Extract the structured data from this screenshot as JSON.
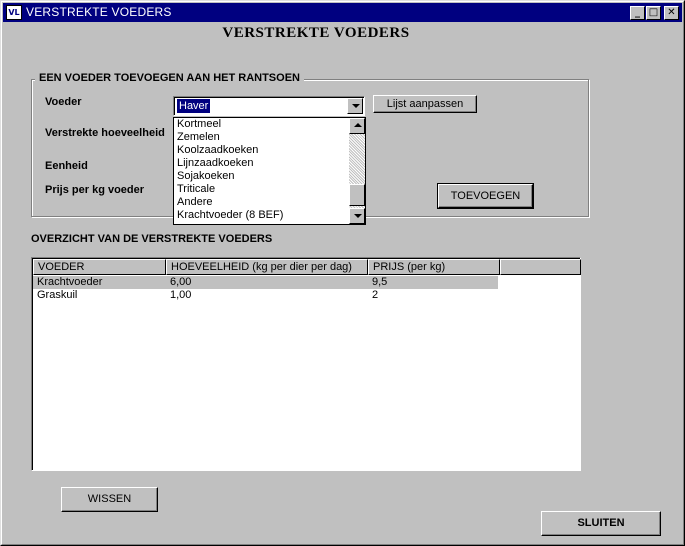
{
  "window": {
    "title": "VERSTREKTE VOEDERS",
    "icon_text": "VL",
    "min_glyph": "_",
    "max_glyph": "□",
    "close_glyph": "✕"
  },
  "page_title": "VERSTREKTE VOEDERS",
  "add_group": {
    "legend": "EEN VOEDER TOEVOEGEN AAN HET RANTSOEN",
    "labels": {
      "voeder": "Voeder",
      "hoeveelheid": "Verstrekte hoeveelheid",
      "eenheid": "Eenheid",
      "prijs": "Prijs per kg voeder"
    },
    "voeder_combo": {
      "selected": "Haver",
      "options": [
        "Kortmeel",
        "Zemelen",
        "Koolzaadkoeken",
        "Lijnzaadkoeken",
        "Sojakoeken",
        "Triticale",
        "Andere",
        "Krachtvoeder (8 BEF)"
      ]
    },
    "lijst_button": "Lijst aanpassen",
    "toevoegen_button": "TOEVOEGEN"
  },
  "overview": {
    "title": "OVERZICHT VAN DE VERSTREKTE VOEDERS",
    "columns": [
      "VOEDER",
      "HOEVEELHEID (kg per dier per dag)",
      "PRIJS (per kg)",
      ""
    ],
    "rows": [
      {
        "voeder": "Krachtvoeder",
        "hoeveelheid": "6,00",
        "prijs": "9,5"
      },
      {
        "voeder": "Graskuil",
        "hoeveelheid": "1,00",
        "prijs": "2"
      }
    ]
  },
  "wissen_button": "WISSEN",
  "sluiten_button": "SLUITEN",
  "colors": {
    "titlebar": "#000080",
    "face": "#c0c0c0",
    "selection": "#000080"
  }
}
